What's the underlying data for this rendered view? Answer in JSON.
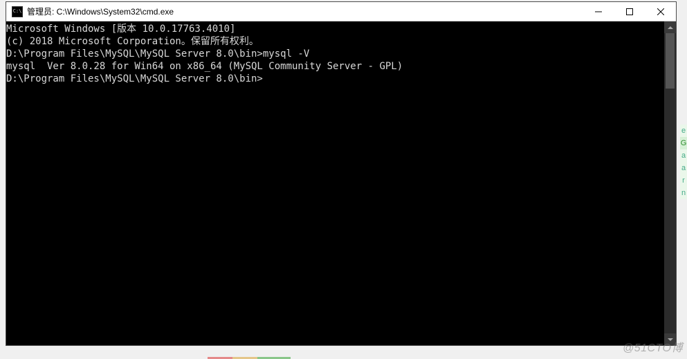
{
  "window": {
    "title": "管理员: C:\\Windows\\System32\\cmd.exe",
    "icon_label": "cmd-icon",
    "icon_text": "C:\\"
  },
  "controls": {
    "minimize": "minimize",
    "maximize": "maximize",
    "close": "close"
  },
  "terminal": {
    "lines": [
      "Microsoft Windows [版本 10.0.17763.4010]",
      "(c) 2018 Microsoft Corporation。保留所有权利。",
      "",
      "D:\\Program Files\\MySQL\\MySQL Server 8.0\\bin>mysql -V",
      "mysql  Ver 8.0.28 for Win64 on x86_64 (MySQL Community Server - GPL)",
      "",
      "D:\\Program Files\\MySQL\\MySQL Server 8.0\\bin>"
    ]
  },
  "edge_letters": [
    "e",
    "G",
    "a",
    "a",
    "r",
    "n"
  ],
  "watermark": "@51CTO博"
}
